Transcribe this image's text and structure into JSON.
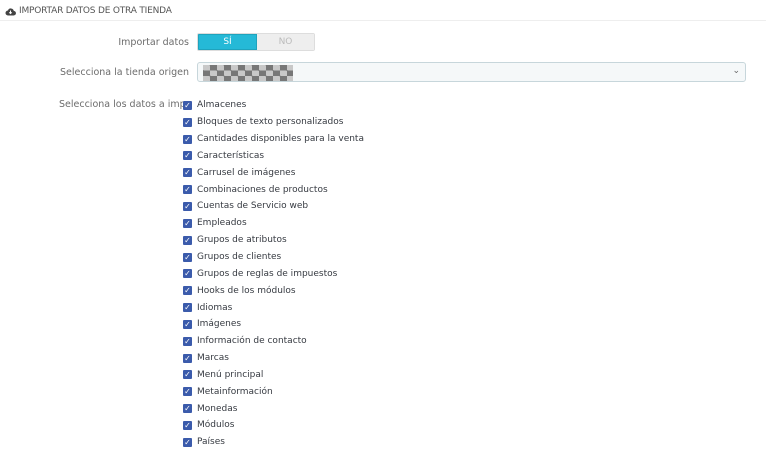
{
  "header": {
    "title": "IMPORTAR DATOS DE OTRA TIENDA",
    "icon": "cloud-download-icon"
  },
  "form": {
    "import_label": "Importar datos",
    "toggle_yes": "SÍ",
    "toggle_no": "NO",
    "toggle_value": "yes",
    "shop_label": "Selecciona la tienda origen",
    "data_label": "Selecciona los datos a importar",
    "items": [
      {
        "label": "Almacenes",
        "checked": true
      },
      {
        "label": "Bloques de texto personalizados",
        "checked": true
      },
      {
        "label": "Cantidades disponibles para la venta",
        "checked": true
      },
      {
        "label": "Características",
        "checked": true
      },
      {
        "label": "Carrusel de imágenes",
        "checked": true
      },
      {
        "label": "Combinaciones de productos",
        "checked": true
      },
      {
        "label": "Cuentas de Servicio web",
        "checked": true
      },
      {
        "label": "Empleados",
        "checked": true
      },
      {
        "label": "Grupos de atributos",
        "checked": true
      },
      {
        "label": "Grupos de clientes",
        "checked": true
      },
      {
        "label": "Grupos de reglas de impuestos",
        "checked": true
      },
      {
        "label": "Hooks de los módulos",
        "checked": true
      },
      {
        "label": "Idiomas",
        "checked": true
      },
      {
        "label": "Imágenes",
        "checked": true
      },
      {
        "label": "Información de contacto",
        "checked": true
      },
      {
        "label": "Marcas",
        "checked": true
      },
      {
        "label": "Menú principal",
        "checked": true
      },
      {
        "label": "Metainformación",
        "checked": true
      },
      {
        "label": "Monedas",
        "checked": true
      },
      {
        "label": "Módulos",
        "checked": true
      },
      {
        "label": "Países",
        "checked": true
      }
    ]
  }
}
